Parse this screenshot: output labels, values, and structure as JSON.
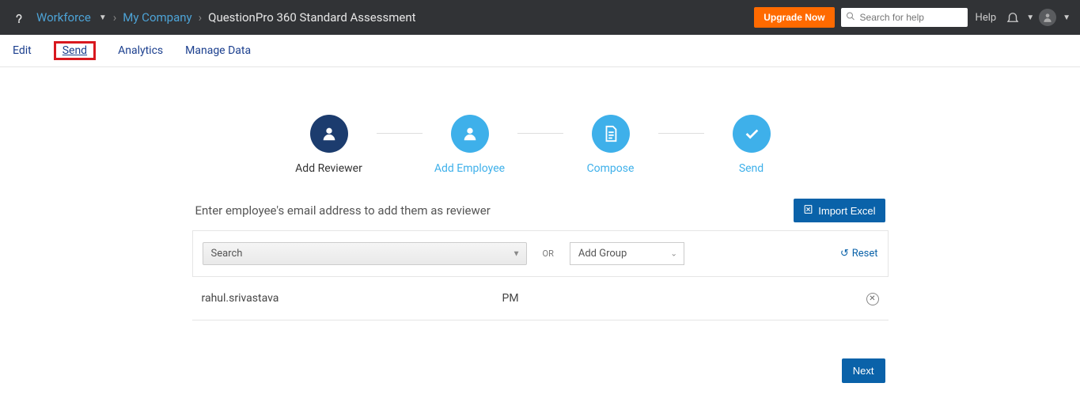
{
  "header": {
    "module": "Workforce",
    "crumb1": "My Company",
    "crumb2": "QuestionPro 360 Standard Assessment",
    "upgrade": "Upgrade Now",
    "searchPlaceholder": "Search for help",
    "helpLabel": "Help"
  },
  "subnav": {
    "edit": "Edit",
    "send": "Send",
    "analytics": "Analytics",
    "manageData": "Manage Data"
  },
  "wizard": {
    "step1": "Add Reviewer",
    "step2": "Add Employee",
    "step3": "Compose",
    "step4": "Send"
  },
  "section": {
    "instruction": "Enter employee's email address to add them as reviewer",
    "importBtn": "Import Excel",
    "searchLabel": "Search",
    "orLabel": "OR",
    "addGroupLabel": "Add Group",
    "resetLabel": "Reset"
  },
  "rows": [
    {
      "name": "rahul.srivastava",
      "role": "PM"
    }
  ],
  "footer": {
    "nextBtn": "Next"
  }
}
